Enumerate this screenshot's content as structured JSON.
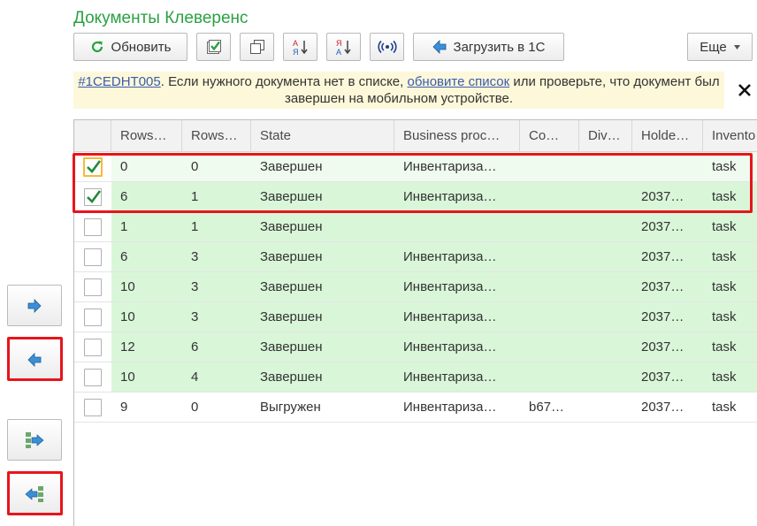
{
  "window": {
    "title": "Документы Клеверенс"
  },
  "toolbar": {
    "refresh_label": "Обновить",
    "upload_label": "Загрузить в 1С",
    "more_label": "Еще"
  },
  "notice": {
    "code": "#1CEDHT005",
    "text_before": ". Если нужного документа нет в списке, ",
    "link": "обновите список",
    "text_after": " или проверьте, что документ был завершен на мобильном устройстве."
  },
  "grid": {
    "columns": [
      "Rows…",
      "Rows…",
      "State",
      "Business proc…",
      "Co…",
      "Div…",
      "Holde…",
      "Invento"
    ],
    "rows": [
      {
        "checked": true,
        "focused": true,
        "cells": [
          "0",
          "0",
          "Завершен",
          "Инвентариза…",
          "",
          "",
          "",
          "task"
        ]
      },
      {
        "checked": true,
        "cells": [
          "6",
          "1",
          "Завершен",
          "Инвентариза…",
          "",
          "",
          "2037…",
          "task"
        ]
      },
      {
        "checked": false,
        "cells": [
          "1",
          "1",
          "Завершен",
          "",
          "",
          "",
          "2037…",
          "task"
        ]
      },
      {
        "checked": false,
        "cells": [
          "6",
          "3",
          "Завершен",
          "Инвентариза…",
          "",
          "",
          "2037…",
          "task"
        ]
      },
      {
        "checked": false,
        "cells": [
          "10",
          "3",
          "Завершен",
          "Инвентариза…",
          "",
          "",
          "2037…",
          "task"
        ]
      },
      {
        "checked": false,
        "cells": [
          "10",
          "3",
          "Завершен",
          "Инвентариза…",
          "",
          "",
          "2037…",
          "task"
        ]
      },
      {
        "checked": false,
        "cells": [
          "12",
          "6",
          "Завершен",
          "Инвентариза…",
          "",
          "",
          "2037…",
          "task"
        ]
      },
      {
        "checked": false,
        "cells": [
          "10",
          "4",
          "Завершен",
          "Инвентариза…",
          "",
          "",
          "2037…",
          "task"
        ]
      },
      {
        "checked": false,
        "cells": [
          "9",
          "0",
          "Выгружен",
          "Инвентариза…",
          "b67…",
          "",
          "2037…",
          "task"
        ]
      }
    ]
  },
  "icons": {
    "refresh": "refresh-icon",
    "check_all": "check-all-icon",
    "copy": "copy-icon",
    "sort_asc": "sort-asc-icon",
    "sort_desc": "sort-desc-icon",
    "broadcast": "broadcast-icon",
    "upload_arrow": "arrow-left-icon",
    "close": "close-icon"
  },
  "colors": {
    "title_green": "#2aa142",
    "row_green": "#d9f6d9",
    "highlight_red": "#e8141b",
    "notice_bg": "#fdf8d9",
    "arrow_blue": "#3a8fd6"
  }
}
